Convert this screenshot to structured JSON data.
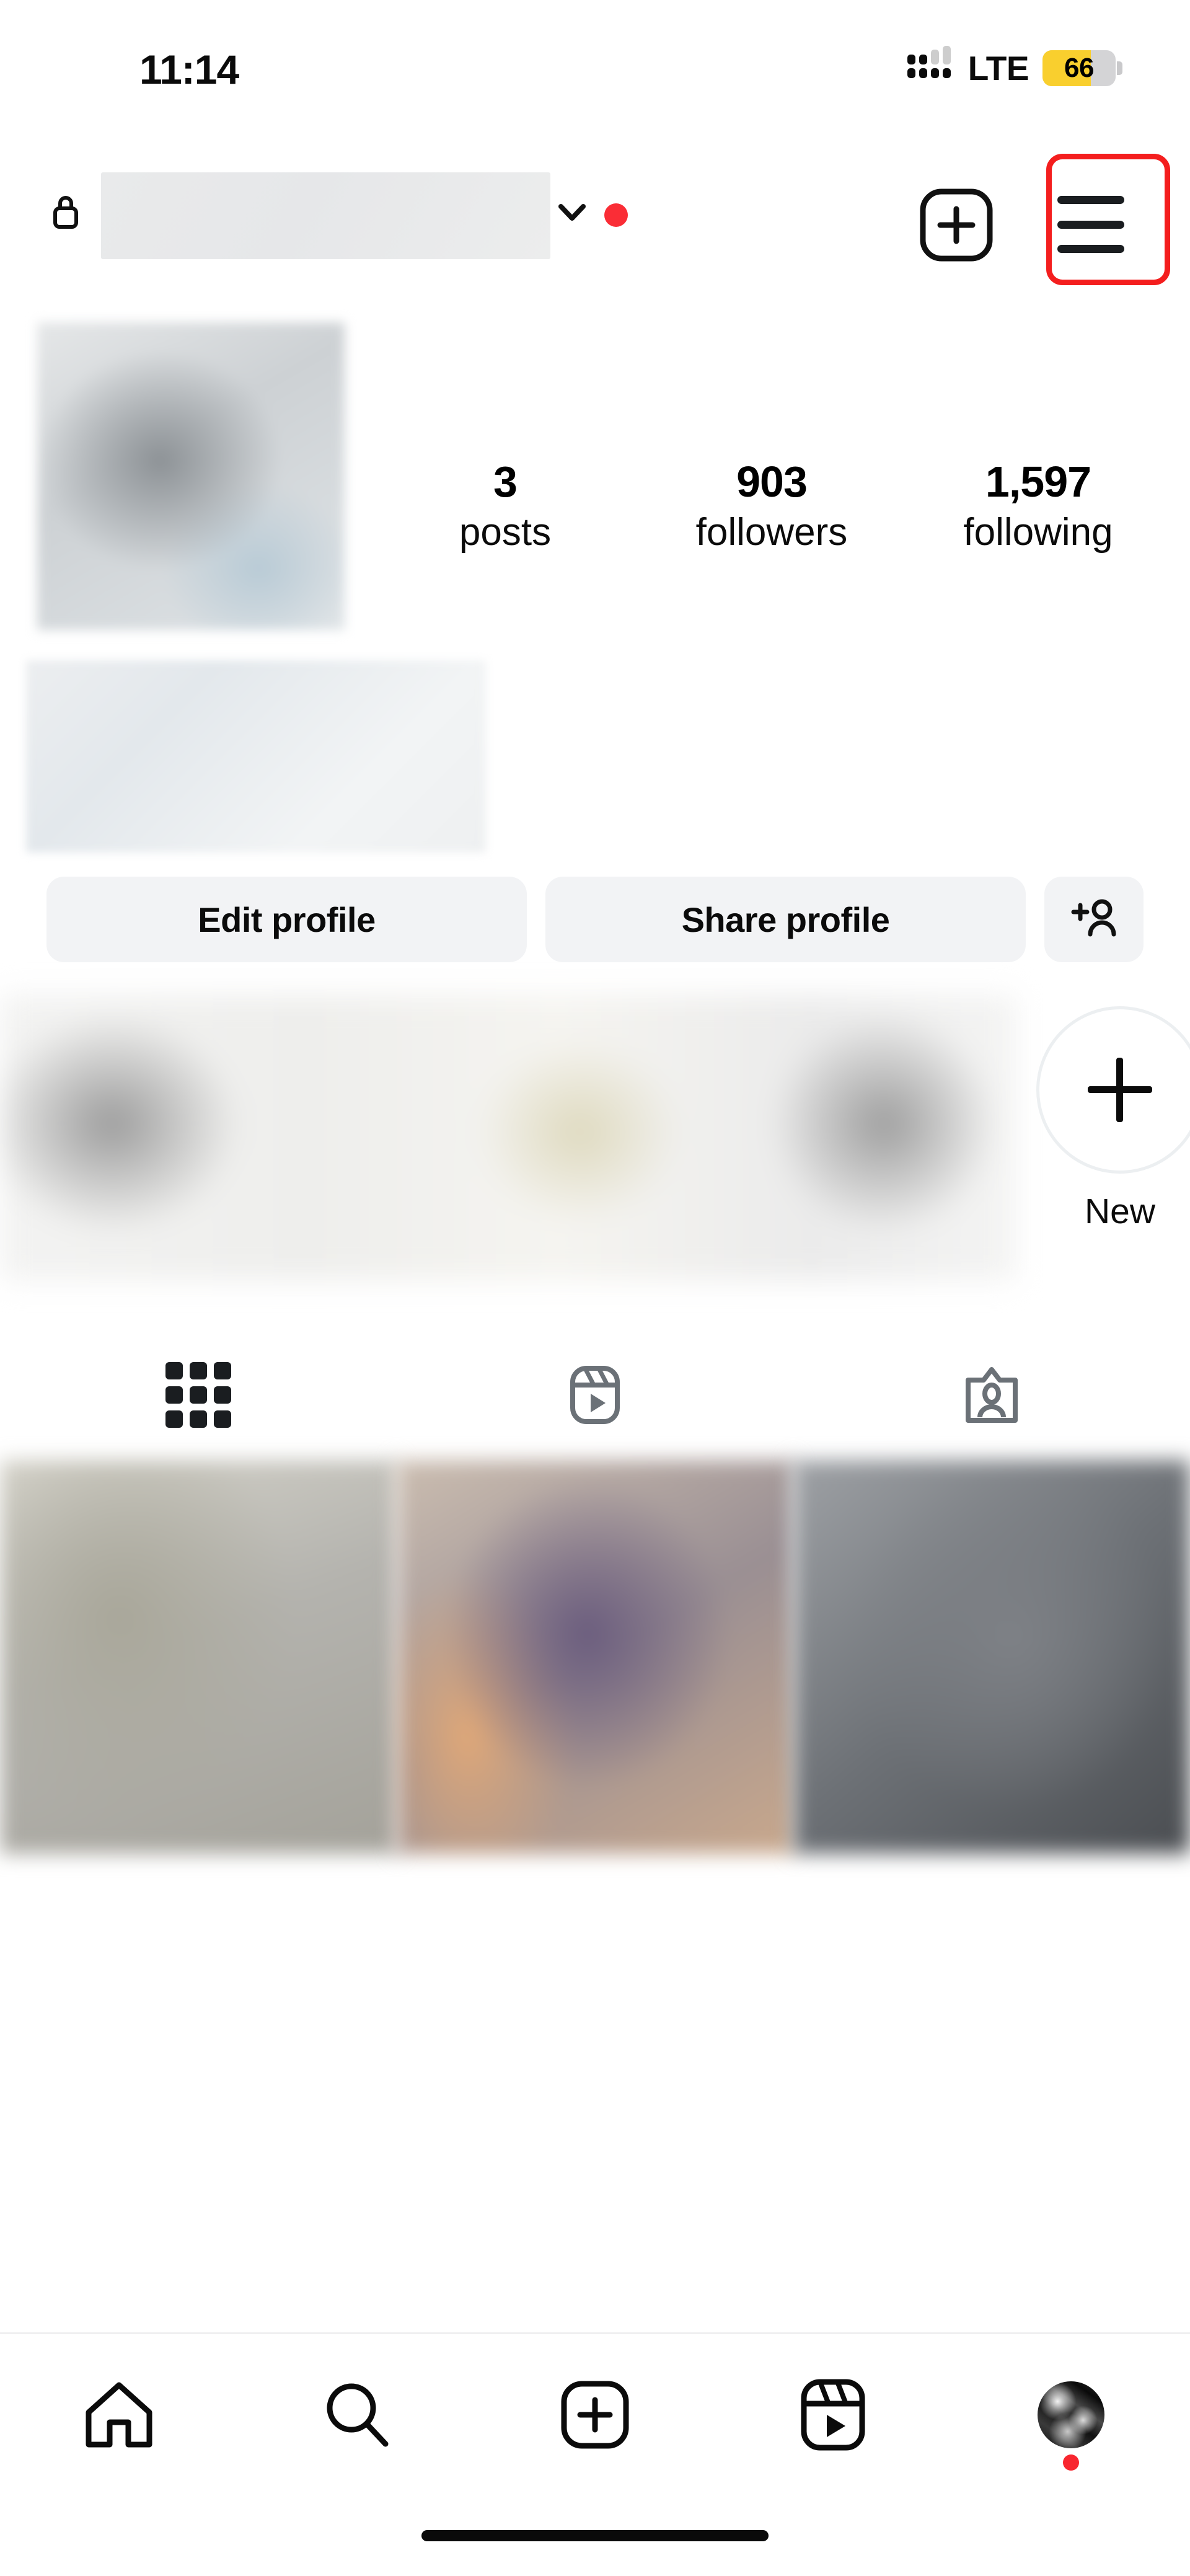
{
  "status_bar": {
    "time": "11:14",
    "network_label": "LTE",
    "battery_percent": "66",
    "battery_level": 66,
    "battery_color": "#f9cf2e",
    "cellular_icon": "cellular-bars-icon"
  },
  "nav_header": {
    "lock_icon": "lock-icon",
    "username": "",
    "username_redacted": true,
    "chevron_icon": "chevron-down-icon",
    "notification_dot_color": "#fa2d36",
    "add_post_icon": "plus-square-icon",
    "menu_icon": "hamburger-menu-icon",
    "annotation_color": "#f41e1e",
    "annotation_target": "hamburger-menu-button"
  },
  "profile": {
    "avatar_redacted": true,
    "bio_redacted": true,
    "stats": [
      {
        "value": "3",
        "label": "posts"
      },
      {
        "value": "903",
        "label": "followers"
      },
      {
        "value": "1,597",
        "label": "following"
      }
    ]
  },
  "actions": {
    "edit_profile": "Edit profile",
    "share_profile": "Share profile",
    "add_user_icon": "add-person-icon"
  },
  "highlights": {
    "redacted": true,
    "new_label": "New",
    "new_icon": "plus-icon"
  },
  "content_tabs": [
    {
      "name": "grid",
      "icon": "grid-icon",
      "active": true
    },
    {
      "name": "reels",
      "icon": "reels-icon",
      "active": false
    },
    {
      "name": "tagged",
      "icon": "tagged-person-icon",
      "active": false
    }
  ],
  "posts": [
    {
      "redacted": true
    },
    {
      "redacted": true
    },
    {
      "redacted": true
    }
  ],
  "bottom_nav": [
    {
      "name": "home",
      "icon": "home-icon",
      "active": true
    },
    {
      "name": "search",
      "icon": "search-icon",
      "active": false
    },
    {
      "name": "create",
      "icon": "plus-square-icon",
      "active": false
    },
    {
      "name": "reels",
      "icon": "reels-icon",
      "active": false
    },
    {
      "name": "profile",
      "icon": "avatar-icon",
      "active": false,
      "badge_color": "#f8262f"
    }
  ]
}
